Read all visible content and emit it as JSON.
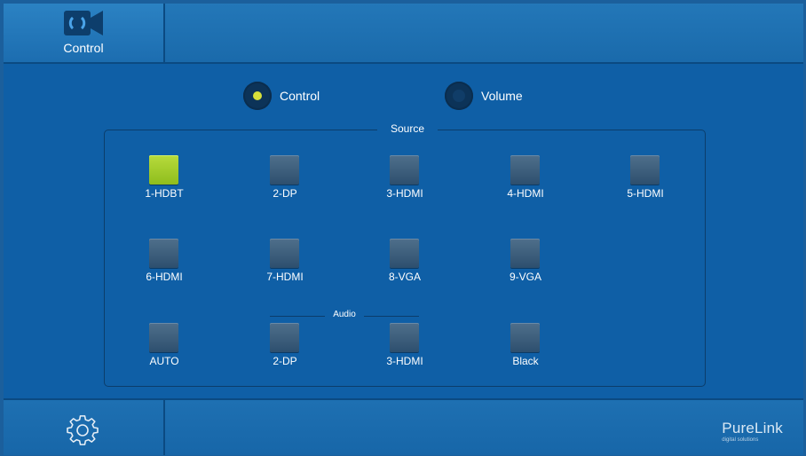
{
  "header": {
    "control_tab_label": "Control",
    "control_tab_icon": "camera-sync-icon"
  },
  "modes": {
    "control_label": "Control",
    "volume_label": "Volume",
    "selected": "Control"
  },
  "source": {
    "legend": "Source",
    "audio_label": "Audio",
    "buttons": [
      {
        "label": "1-HDBT",
        "active": true
      },
      {
        "label": "2-DP",
        "active": false
      },
      {
        "label": "3-HDMI",
        "active": false
      },
      {
        "label": "4-HDMI",
        "active": false
      },
      {
        "label": "5-HDMI",
        "active": false
      },
      {
        "label": "6-HDMI",
        "active": false
      },
      {
        "label": "7-HDMI",
        "active": false
      },
      {
        "label": "8-VGA",
        "active": false
      },
      {
        "label": "9-VGA",
        "active": false
      }
    ],
    "audio_buttons": [
      {
        "label": "AUTO",
        "active": false
      },
      {
        "label": "2-DP",
        "active": false
      },
      {
        "label": "3-HDMI",
        "active": false
      },
      {
        "label": "Black",
        "active": false
      }
    ]
  },
  "footer": {
    "settings_icon": "gear-icon",
    "brand_name": "PureLink",
    "brand_tagline": "digital solutions"
  },
  "colors": {
    "background": "#0f5fa6",
    "active_button": "#a6cf2e",
    "inactive_button": "#3d5f7e",
    "radio_selected_dot": "#d7e03a"
  }
}
